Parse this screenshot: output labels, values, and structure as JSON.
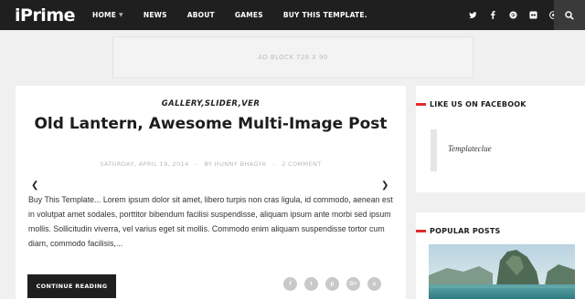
{
  "site": {
    "logo": "iPrime"
  },
  "nav": {
    "items": [
      {
        "label": "HOME",
        "has_dropdown": true
      },
      {
        "label": "NEWS"
      },
      {
        "label": "ABOUT"
      },
      {
        "label": "GAMES"
      },
      {
        "label": "BUY THIS TEMPLATE."
      }
    ]
  },
  "social_icons": [
    "twitter-icon",
    "facebook-icon",
    "pinterest-icon",
    "flickr-icon",
    "dribbble-icon"
  ],
  "ad": {
    "label": "AD BLOCK 728 X 90"
  },
  "post": {
    "categories": "GALLERY,SLIDER,VER",
    "title": "Old Lantern, Awesome Multi-Image Post",
    "date": "SATURDAY, APRIL 19, 2014",
    "author": "BY HUNNY BHAGYA",
    "comments": "2 COMMENT",
    "meta_sep": "-",
    "excerpt": "Buy This Template... Lorem ipsum dolor sit amet, libero turpis non cras ligula, id commodo, aenean est in volutpat amet sodales, porttitor bibendum facilisi suspendisse, aliquam ipsum ante morbi sed ipsum mollis. Sollicitudin viverra, vel varius eget sit mollis. Commodo enim aliquam suspendisse tortor cum diam, commodo facilisis,...",
    "read_more": "CONTINUE READING",
    "share_icons": [
      "facebook-icon",
      "twitter-icon",
      "pinterest-icon",
      "google-plus-icon",
      "stumbleupon-icon"
    ],
    "share_glyphs": [
      "f",
      "t",
      "p",
      "G+",
      "s"
    ]
  },
  "sidebar": {
    "facebook": {
      "title": "LIKE US ON FACEBOOK",
      "text": "Templateclue"
    },
    "popular": {
      "title": "POPULAR POSTS"
    }
  },
  "colors": {
    "accent": "#e12b2b",
    "topbar": "#1f1f1f",
    "background": "#f0f0f0"
  }
}
